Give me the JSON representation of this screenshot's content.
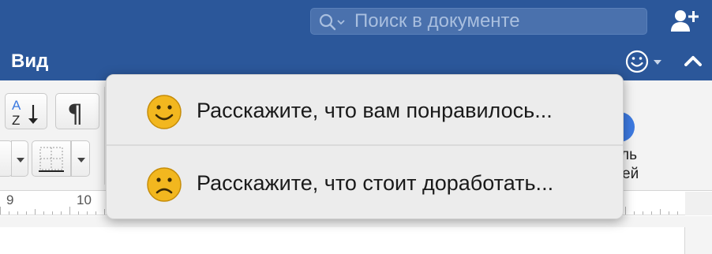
{
  "search": {
    "placeholder": "Поиск в документе"
  },
  "header": {
    "share_icon": "add-person-icon"
  },
  "tabs": {
    "active_label": "Вид"
  },
  "feedback": {
    "icon": "smiley-icon",
    "items": [
      {
        "label": "Расскажите, что вам понравилось...",
        "icon": "smiley-happy-icon"
      },
      {
        "label": "Расскажите, что стоит доработать...",
        "icon": "smiley-sad-icon"
      }
    ]
  },
  "ribbon": {
    "partial_labels": [
      "ль",
      "ей"
    ]
  },
  "ruler": {
    "numbers": [
      "9",
      "10"
    ]
  },
  "colors": {
    "title_bar": "#2b579a",
    "smiley_yellow": "#f2b71f",
    "accent_blue": "#3d7ae0"
  }
}
